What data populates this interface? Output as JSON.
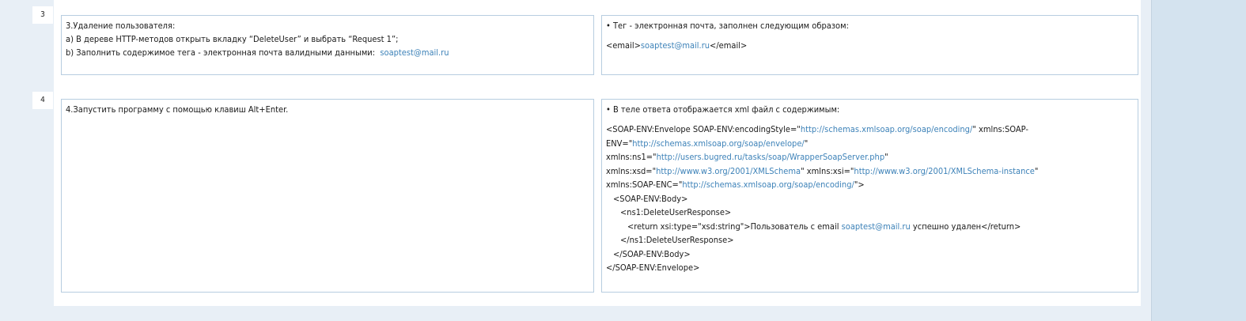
{
  "rows": [
    {
      "number": "3",
      "step": {
        "title": "3.Удаление пользователя:",
        "a": "a) В дереве HTTP-методов открыть вкладку “DeleteUser” и выбрать “Request 1”;",
        "b_text": "b) Заполнить содержимое тега - электронная почта валидными данными:",
        "b_link": "soaptest@mail.ru"
      },
      "expected": {
        "bullet": "• Тег - электронная почта, заполнен следующим образом:",
        "open": "<email>",
        "email": "soaptest@mail.ru",
        "close": "</email>"
      }
    },
    {
      "number": "4",
      "step": {
        "title": "4.Запустить программу с помощью клавиш Alt+Enter."
      },
      "expected": {
        "bullet": "• В теле ответа отображается xml файл с содержимым:",
        "xml": {
          "l1_a": "<SOAP-ENV:Envelope SOAP-ENV:encodingStyle=\"",
          "l1_link": "http://schemas.xmlsoap.org/soap/encoding/",
          "l1_b": "\" xmlns:SOAP-",
          "l2_a": "ENV=\"",
          "l2_link": "http://schemas.xmlsoap.org/soap/envelope/",
          "l2_b": "\"",
          "l3_a": "xmlns:ns1=\"",
          "l3_link": "http://users.bugred.ru/tasks/soap/WrapperSoapServer.php",
          "l3_b": "\"",
          "l4_a": "xmlns:xsd=\"",
          "l4_link": "http://www.w3.org/2001/XMLSchema",
          "l4_b": "\" xmlns:xsi=\"",
          "l4_link2": "http://www.w3.org/2001/XMLSchema-instance",
          "l4_c": "\"",
          "l5_a": "xmlns:SOAP-ENC=\"",
          "l5_link": "http://schemas.xmlsoap.org/soap/encoding/",
          "l5_b": "\">",
          "l6": "<SOAP-ENV:Body>",
          "l7": "<ns1:DeleteUserResponse>",
          "l8_a": "<return xsi:type=\"xsd:string\">Пользователь с email ",
          "l8_link": "soaptest@mail.ru",
          "l8_b": " успешно удален</return>",
          "l9": "</ns1:DeleteUserResponse>",
          "l10": "</SOAP-ENV:Body>",
          "l11": "</SOAP-ENV:Envelope>"
        }
      }
    }
  ]
}
